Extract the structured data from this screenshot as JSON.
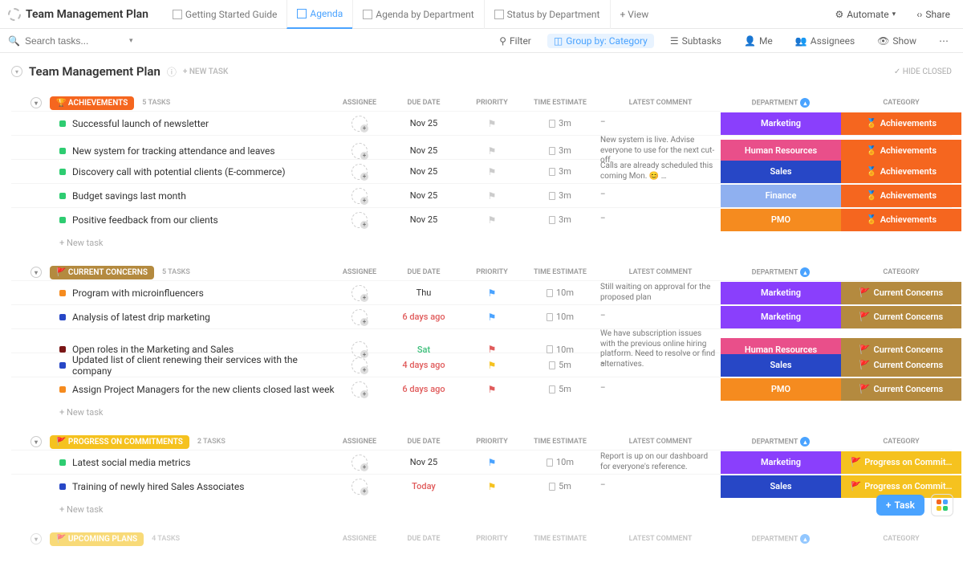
{
  "header": {
    "app_title": "Team Management Plan",
    "views": [
      "Getting Started Guide",
      "Agenda",
      "Agenda by Department",
      "Status by Department"
    ],
    "active_view": 1,
    "add_view": "+ View",
    "automate": "Automate",
    "share": "Share"
  },
  "filters": {
    "search_placeholder": "Search tasks...",
    "filter": "Filter",
    "group_by": "Group by: Category",
    "subtasks": "Subtasks",
    "me": "Me",
    "assignees": "Assignees",
    "show": "Show"
  },
  "sheet": {
    "title": "Team Management Plan",
    "new_task_label": "+ NEW TASK",
    "hide_closed": "HIDE CLOSED"
  },
  "columns": {
    "assignee": "ASSIGNEE",
    "due": "DUE DATE",
    "priority": "PRIORITY",
    "estimate": "TIME ESTIMATE",
    "comment": "LATEST COMMENT",
    "department": "DEPARTMENT",
    "category": "CATEGORY"
  },
  "dept_colors": {
    "Marketing": "#8a3ffc",
    "Human Resources": "#e94f8a",
    "Sales": "#2747c6",
    "Finance": "#8fb0f0",
    "PMO": "#f58b1f"
  },
  "groups": [
    {
      "name": "Achievements",
      "color": "#f5661f",
      "emoji": "🏆",
      "count": "5 TASKS",
      "cat_color": "#f5661f",
      "cat_emoji": "🏅",
      "cat_label": "Achievements",
      "tasks": [
        {
          "status": "#2ecc71",
          "name": "Successful launch of newsletter",
          "due": "Nov 25",
          "due_cls": "",
          "flag": "#ccc",
          "est": "3m",
          "comment": "–",
          "dept": "Marketing"
        },
        {
          "status": "#2ecc71",
          "name": "New system for tracking attendance and leaves",
          "due": "Nov 25",
          "due_cls": "",
          "flag": "#ccc",
          "est": "3m",
          "comment": "New system is live. Advise everyone to use for the next cut-off.",
          "dept": "Human Resources"
        },
        {
          "status": "#2ecc71",
          "name": "Discovery call with potential clients (E-commerce)",
          "due": "Nov 25",
          "due_cls": "",
          "flag": "#ccc",
          "est": "3m",
          "comment": "Calls are already scheduled this coming Mon. 😊 …",
          "dept": "Sales"
        },
        {
          "status": "#2ecc71",
          "name": "Budget savings last month",
          "due": "Nov 25",
          "due_cls": "",
          "flag": "#ccc",
          "est": "3m",
          "comment": "–",
          "dept": "Finance"
        },
        {
          "status": "#2ecc71",
          "name": "Positive feedback from our clients",
          "due": "Nov 25",
          "due_cls": "",
          "flag": "#ccc",
          "est": "3m",
          "comment": "–",
          "dept": "PMO"
        }
      ]
    },
    {
      "name": "Current Concerns",
      "color": "#b48a3f",
      "emoji": "🚩",
      "count": "5 TASKS",
      "cat_color": "#b48a3f",
      "cat_emoji": "🚩",
      "cat_label": "Current Concerns",
      "tasks": [
        {
          "status": "#f58b1f",
          "name": "Program with microinfluencers",
          "due": "Thu",
          "due_cls": "",
          "flag": "#4aa3ff",
          "est": "10m",
          "comment": "Still waiting on approval for the proposed plan",
          "dept": "Marketing"
        },
        {
          "status": "#2747c6",
          "name": "Analysis of latest drip marketing",
          "due": "6 days ago",
          "due_cls": "red",
          "flag": "#4aa3ff",
          "est": "10m",
          "comment": "–",
          "dept": "Marketing"
        },
        {
          "status": "#7a1616",
          "name": "Open roles in the Marketing and Sales",
          "due": "Sat",
          "due_cls": "green",
          "flag": "#e05b5b",
          "est": "10m",
          "comment": "We have subscription issues with the previous online hiring platform. Need to resolve or find alternatives.",
          "dept": "Human Resources"
        },
        {
          "status": "#2747c6",
          "name": "Updated list of client renewing their services with the company",
          "due": "4 days ago",
          "due_cls": "red",
          "flag": "#f5c21f",
          "est": "5m",
          "comment": "–",
          "dept": "Sales"
        },
        {
          "status": "#f58b1f",
          "name": "Assign Project Managers for the new clients closed last week",
          "due": "6 days ago",
          "due_cls": "red",
          "flag": "#e05b5b",
          "est": "5m",
          "comment": "–",
          "dept": "PMO"
        }
      ]
    },
    {
      "name": "Progress on Commitments",
      "color": "#f5c21f",
      "emoji": "🚩",
      "count": "2 TASKS",
      "cat_color": "#f5c21f",
      "cat_emoji": "🚩",
      "cat_label": "Progress on Commit…",
      "tasks": [
        {
          "status": "#2ecc71",
          "name": "Latest social media metrics",
          "due": "Nov 25",
          "due_cls": "",
          "flag": "#4aa3ff",
          "est": "10m",
          "comment": "Report is up on our dashboard for everyone's reference.",
          "dept": "Marketing"
        },
        {
          "status": "#2747c6",
          "name": "Training of newly hired Sales Associates",
          "due": "Today",
          "due_cls": "red",
          "flag": "#f5c21f",
          "est": "5m",
          "comment": "–",
          "dept": "Sales"
        }
      ]
    }
  ],
  "next_group": {
    "name": "Upcoming Plans",
    "color": "#f5c21f",
    "emoji": "🚩",
    "count": "4 TASKS"
  },
  "misc": {
    "new_task_row": "+ New task",
    "task_button": "Task"
  }
}
